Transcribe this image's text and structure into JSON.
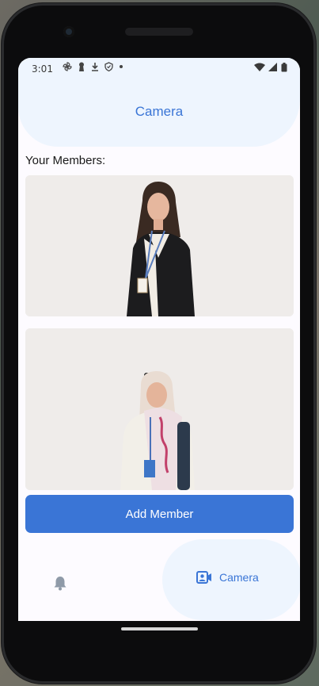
{
  "status_bar": {
    "time": "3:01",
    "icons": [
      "pinwheel-icon",
      "keyhole-icon",
      "download-icon",
      "shield-icon",
      "dot-icon"
    ],
    "right_icons": [
      "wifi-icon",
      "signal-icon",
      "battery-icon"
    ]
  },
  "app_bar": {
    "title": "Camera"
  },
  "members": {
    "label": "Your Members:",
    "items": [
      {
        "photo": "member-photo-icon"
      },
      {
        "photo": "member-photo-icon"
      }
    ]
  },
  "actions": {
    "add_member": "Add Member"
  },
  "bottom_nav": {
    "items": [
      {
        "icon": "bell-icon",
        "label": ""
      },
      {
        "icon": "camera-contact-icon",
        "label": "Camera"
      }
    ],
    "active_index": 1
  },
  "colors": {
    "accent": "#3a75d6",
    "app_bar_bg": "#eef5fe",
    "screen_bg": "#fdfbff",
    "card_bg": "#efecea"
  }
}
